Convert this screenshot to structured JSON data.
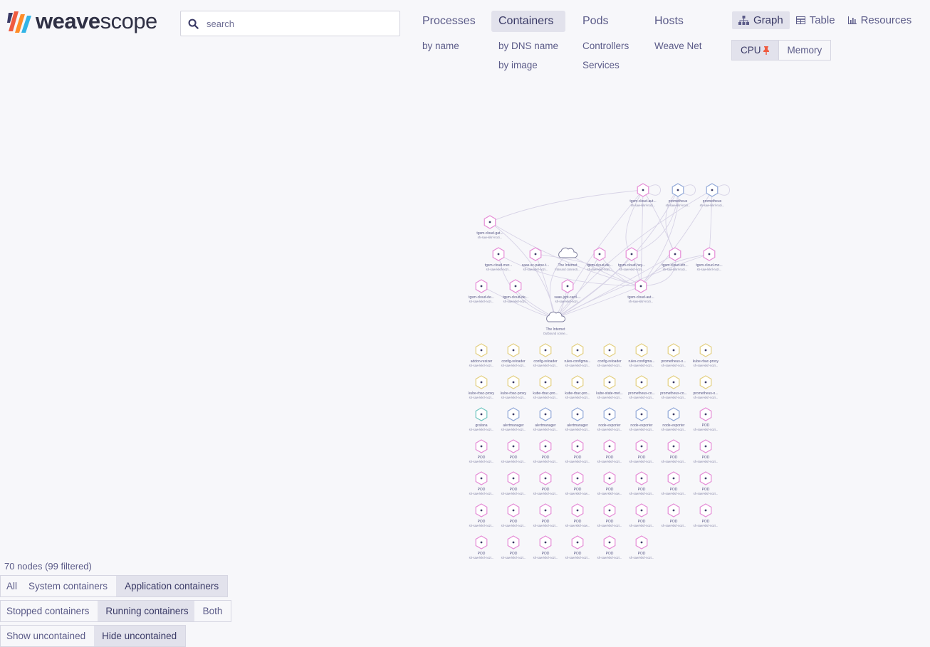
{
  "logo": {
    "brand_bold": "weave",
    "brand_light": "scope"
  },
  "search": {
    "placeholder": "search"
  },
  "topologies": [
    {
      "label": "Processes",
      "active": false,
      "subs": [
        "by name"
      ]
    },
    {
      "label": "Containers",
      "active": true,
      "subs": [
        "by DNS name",
        "by image"
      ]
    },
    {
      "label": "Pods",
      "active": false,
      "subs": [
        "Controllers",
        "Services"
      ]
    },
    {
      "label": "Hosts",
      "active": false,
      "subs": [
        "Weave Net"
      ]
    }
  ],
  "view_modes": [
    {
      "label": "Graph",
      "icon": "graph-icon",
      "active": true
    },
    {
      "label": "Table",
      "icon": "table-icon",
      "active": false
    },
    {
      "label": "Resources",
      "icon": "resources-icon",
      "active": false
    }
  ],
  "metrics": [
    {
      "label": "CPU",
      "pinned": true,
      "active": true
    },
    {
      "label": "Memory",
      "pinned": false,
      "active": false
    }
  ],
  "colors": {
    "pink": "#e58cd6",
    "blue": "#92a9d8",
    "yellow": "#e3cf80",
    "teal": "#72c6c1",
    "dot": "#3a3a66",
    "edge": "#d7d3e6",
    "pin": "#ef5b40"
  },
  "graph": {
    "nodes": [
      {
        "label": "tgsm-cloud-aut...",
        "sub": "sh-saw-kikrl-nozi...",
        "shape": "hex",
        "color": "pink"
      },
      {
        "label": "prometheus",
        "sub": "sh-saw-kikrl-nozi...",
        "shape": "hex",
        "color": "blue"
      },
      {
        "label": "prometheus",
        "sub": "sh-saw-kikrl-nozi...",
        "shape": "hex",
        "color": "blue"
      },
      {
        "label": "tgsm-cloud-gat...",
        "sub": "sh-saw-kikrl-nozi...",
        "shape": "hex",
        "color": "pink"
      },
      {
        "label": "tgsm-cloud-mer...",
        "sub": "sh-saw-kikrl-nozi...",
        "shape": "hex",
        "color": "pink"
      },
      {
        "label": "saas-sc-parse-t...",
        "sub": "sh-saw-kikrl-nozi...",
        "shape": "hex",
        "color": "pink"
      },
      {
        "label": "The Internet",
        "sub": "Inbound connecti...",
        "shape": "cloud",
        "color": "none"
      },
      {
        "label": "tgsm-cloud-de...",
        "sub": "sh-saw-kikrl-nozi...",
        "shape": "hex",
        "color": "pink"
      },
      {
        "label": "tgsm-cloud-hey...",
        "sub": "sh-saw-kikrl-nozi...",
        "shape": "hex",
        "color": "pink"
      },
      {
        "label": "tgsm-cloud-eth...",
        "sub": "sh-saw-kikrl-nozi...",
        "shape": "hex",
        "color": "pink"
      },
      {
        "label": "tgsm-cloud-mo...",
        "sub": "sh-saw-kikrl-nozi...",
        "shape": "hex",
        "color": "pink"
      },
      {
        "label": "tgsm-cloud-de...",
        "sub": "sh-saw-kikrl-nozi...",
        "shape": "hex",
        "color": "pink"
      },
      {
        "label": "tgsm-cloud-de...",
        "sub": "sh-saw-kikrl-nozi...",
        "shape": "hex",
        "color": "pink"
      },
      {
        "label": "saas-jcpt-card-...",
        "sub": "sh-saw-kikrl-nozi...",
        "shape": "hex",
        "color": "pink"
      },
      {
        "label": "tgsm-cloud-aut...",
        "sub": "sh-saw-kikrl-nozi...",
        "shape": "hex",
        "color": "pink"
      },
      {
        "label": "The Internet",
        "sub": "Outbound conne...",
        "shape": "cloud",
        "color": "none"
      },
      {
        "label": "addon-resizer",
        "sub": "sh-saw-kikrl-nozi...",
        "shape": "hex",
        "color": "yellow"
      },
      {
        "label": "config-reloader",
        "sub": "sh-saw-kikrl-nozi...",
        "shape": "hex",
        "color": "yellow"
      },
      {
        "label": "config-reloader",
        "sub": "sh-saw-kikrl-nozi...",
        "shape": "hex",
        "color": "yellow"
      },
      {
        "label": "rules-configma...",
        "sub": "sh-saw-kikrl-nozi...",
        "shape": "hex",
        "color": "yellow"
      },
      {
        "label": "config-reloader",
        "sub": "sh-saw-kikrl-nozi...",
        "shape": "hex",
        "color": "yellow"
      },
      {
        "label": "rules-configma...",
        "sub": "sh-saw-kikrl-nozi...",
        "shape": "hex",
        "color": "yellow"
      },
      {
        "label": "prometheus-o...",
        "sub": "sh-saw-kikrl-nozi...",
        "shape": "hex",
        "color": "yellow"
      },
      {
        "label": "kube-rbac-proxy",
        "sub": "sh-saw-kikrl-nozi...",
        "shape": "hex",
        "color": "yellow"
      },
      {
        "label": "kube-rbac-proxy",
        "sub": "sh-saw-kikrl-nozi...",
        "shape": "hex",
        "color": "yellow"
      },
      {
        "label": "kube-rbac-proxy",
        "sub": "sh-saw-kikrl-nozi...",
        "shape": "hex",
        "color": "yellow"
      },
      {
        "label": "kube-rbac-pro...",
        "sub": "sh-saw-kikrl-nozi...",
        "shape": "hex",
        "color": "yellow"
      },
      {
        "label": "kube-rbac-pro...",
        "sub": "sh-saw-kikrl-nozi...",
        "shape": "hex",
        "color": "yellow"
      },
      {
        "label": "kube-state-met...",
        "sub": "sh-saw-kikrl-nozi...",
        "shape": "hex",
        "color": "yellow"
      },
      {
        "label": "prometheus-co...",
        "sub": "sh-saw-kikrl-nozi...",
        "shape": "hex",
        "color": "yellow"
      },
      {
        "label": "prometheus-co...",
        "sub": "sh-saw-kikrl-nozi...",
        "shape": "hex",
        "color": "yellow"
      },
      {
        "label": "prometheus-o...",
        "sub": "sh-saw-kikrl-nozi...",
        "shape": "hex",
        "color": "yellow"
      },
      {
        "label": "grafana",
        "sub": "sh-saw-kikrl-nozi...",
        "shape": "hex",
        "color": "teal"
      },
      {
        "label": "alertmanager",
        "sub": "sh-saw-kikrl-nozi...",
        "shape": "hex",
        "color": "blue"
      },
      {
        "label": "alertmanager",
        "sub": "sh-saw-kikrl-nozi...",
        "shape": "hex",
        "color": "blue"
      },
      {
        "label": "alertmanager",
        "sub": "sh-saw-kikrl-nozi...",
        "shape": "hex",
        "color": "blue"
      },
      {
        "label": "node-exporter",
        "sub": "sh-saw-kikrl-nozi...",
        "shape": "hex",
        "color": "blue"
      },
      {
        "label": "node-exporter",
        "sub": "sh-saw-kikrl-nozi...",
        "shape": "hex",
        "color": "blue"
      },
      {
        "label": "node-exporter",
        "sub": "sh-saw-kikrl-nozi...",
        "shape": "hex",
        "color": "blue"
      },
      {
        "label": "POD",
        "sub": "sh-saw-kikrl-nozi...",
        "shape": "hex",
        "color": "pink"
      },
      {
        "label": "POD",
        "sub": "sh-saw-kikrl-nozi...",
        "shape": "hex",
        "color": "pink"
      },
      {
        "label": "POD",
        "sub": "sh-saw-kikrl-nozi...",
        "shape": "hex",
        "color": "pink"
      },
      {
        "label": "POD",
        "sub": "sh-saw-kikrl-nozi...",
        "shape": "hex",
        "color": "pink"
      },
      {
        "label": "POD",
        "sub": "sh-saw-kikrl-nozi...",
        "shape": "hex",
        "color": "pink"
      },
      {
        "label": "POD",
        "sub": "sh-saw-kikrl-nozi...",
        "shape": "hex",
        "color": "pink"
      },
      {
        "label": "POD",
        "sub": "sh-saw-kikrl-nozi...",
        "shape": "hex",
        "color": "pink"
      },
      {
        "label": "POD",
        "sub": "sh-saw-kikrl-nozi...",
        "shape": "hex",
        "color": "pink"
      },
      {
        "label": "POD",
        "sub": "sh-saw-kikrl-nozi...",
        "shape": "hex",
        "color": "pink"
      },
      {
        "label": "POD",
        "sub": "sh-saw-kikrl-nozi...",
        "shape": "hex",
        "color": "pink"
      },
      {
        "label": "POD",
        "sub": "sh-saw-kikrl-nozi...",
        "shape": "hex",
        "color": "pink"
      },
      {
        "label": "POD",
        "sub": "sh-saw-kikrl-nozi...",
        "shape": "hex",
        "color": "pink"
      },
      {
        "label": "POD",
        "sub": "sh-saw-kikrl-now...",
        "shape": "hex",
        "color": "pink"
      },
      {
        "label": "POD",
        "sub": "sh-saw-kikrl-now...",
        "shape": "hex",
        "color": "pink"
      },
      {
        "label": "POD",
        "sub": "sh-saw-kikrl-nozi...",
        "shape": "hex",
        "color": "pink"
      },
      {
        "label": "POD",
        "sub": "sh-saw-kikrl-nozi...",
        "shape": "hex",
        "color": "pink"
      },
      {
        "label": "POD",
        "sub": "sh-saw-kikrl-nozi...",
        "shape": "hex",
        "color": "pink"
      },
      {
        "label": "POD",
        "sub": "sh-saw-kikrl-nozi...",
        "shape": "hex",
        "color": "pink"
      },
      {
        "label": "POD",
        "sub": "sh-saw-kikrl-nozi...",
        "shape": "hex",
        "color": "pink"
      },
      {
        "label": "POD",
        "sub": "sh-saw-kikrl-nozi...",
        "shape": "hex",
        "color": "pink"
      },
      {
        "label": "POD",
        "sub": "sh-saw-kikrl-now...",
        "shape": "hex",
        "color": "pink"
      },
      {
        "label": "POD",
        "sub": "sh-saw-kikrl-nozi...",
        "shape": "hex",
        "color": "pink"
      },
      {
        "label": "POD",
        "sub": "sh-saw-kikrl-nozi...",
        "shape": "hex",
        "color": "pink"
      },
      {
        "label": "POD",
        "sub": "sh-saw-kikrl-nozi...",
        "shape": "hex",
        "color": "pink"
      },
      {
        "label": "POD",
        "sub": "sh-saw-kikrl-nozi...",
        "shape": "hex",
        "color": "pink"
      },
      {
        "label": "POD",
        "sub": "sh-saw-kikrl-nozi...",
        "shape": "hex",
        "color": "pink"
      },
      {
        "label": "POD",
        "sub": "sh-saw-kikrl-nozi...",
        "shape": "hex",
        "color": "pink"
      },
      {
        "label": "POD",
        "sub": "sh-saw-kikrl-nozi...",
        "shape": "hex",
        "color": "pink"
      },
      {
        "label": "POD",
        "sub": "sh-saw-kikrl-nozi...",
        "shape": "hex",
        "color": "pink"
      },
      {
        "label": "POD",
        "sub": "sh-saw-kikrl-nozi...",
        "shape": "hex",
        "color": "pink"
      },
      {
        "label": "POD",
        "sub": "sh-saw-kikrl-nozi...",
        "shape": "hex",
        "color": "pink"
      }
    ],
    "edges": [
      [
        3,
        0
      ],
      [
        3,
        14
      ],
      [
        3,
        15
      ],
      [
        0,
        15
      ],
      [
        0,
        14
      ],
      [
        1,
        15
      ],
      [
        2,
        15
      ],
      [
        2,
        14
      ],
      [
        1,
        14
      ],
      [
        4,
        15
      ],
      [
        5,
        15
      ],
      [
        6,
        14
      ],
      [
        6,
        15
      ],
      [
        7,
        15
      ],
      [
        8,
        15
      ],
      [
        9,
        15
      ],
      [
        10,
        15
      ],
      [
        11,
        15
      ],
      [
        12,
        15
      ],
      [
        13,
        15
      ],
      [
        14,
        15
      ],
      [
        0,
        8
      ],
      [
        0,
        9
      ],
      [
        1,
        8
      ],
      [
        1,
        9
      ],
      [
        2,
        10
      ],
      [
        5,
        14
      ],
      [
        4,
        14
      ],
      [
        8,
        14
      ],
      [
        9,
        14
      ],
      [
        10,
        14
      ],
      [
        7,
        14
      ]
    ]
  },
  "status": {
    "node_count": "70 nodes (99 filtered)"
  },
  "filters": [
    [
      {
        "label": "All",
        "active": false
      },
      {
        "label": "System containers",
        "active": false
      },
      {
        "label": "Application containers",
        "active": true
      }
    ],
    [
      {
        "label": "Stopped containers",
        "active": false
      },
      {
        "label": "Running containers",
        "active": true
      },
      {
        "label": "Both",
        "active": false
      }
    ],
    [
      {
        "label": "Show uncontained",
        "active": false
      },
      {
        "label": "Hide uncontained",
        "active": true
      }
    ]
  ]
}
